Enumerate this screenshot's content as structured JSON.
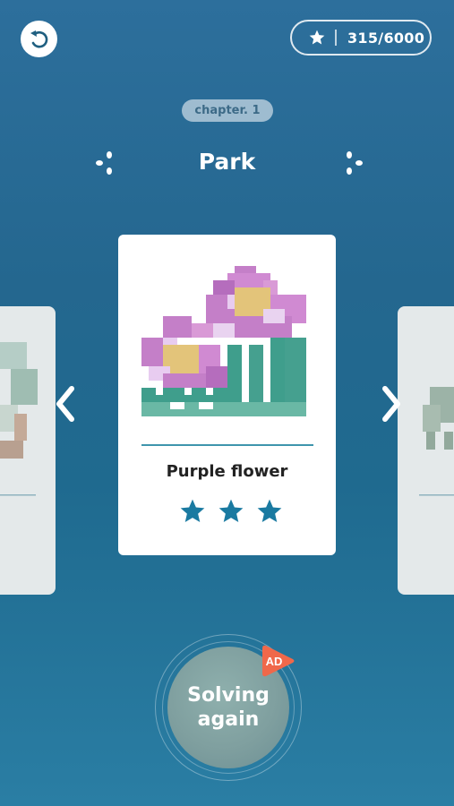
{
  "header": {
    "back_icon": "undo-arrow-icon",
    "stars_count": "315/6000"
  },
  "chapter": {
    "label": "chapter. 1",
    "title": "Park"
  },
  "card": {
    "name": "Purple flower",
    "stars_earned": 3,
    "stars_total": 3
  },
  "action": {
    "line1": "Solving",
    "line2": "again",
    "badge": "AD"
  },
  "colors": {
    "star": "#1a7aa1",
    "divider": "#3f95ad",
    "ad_badge": "#f0684a"
  }
}
